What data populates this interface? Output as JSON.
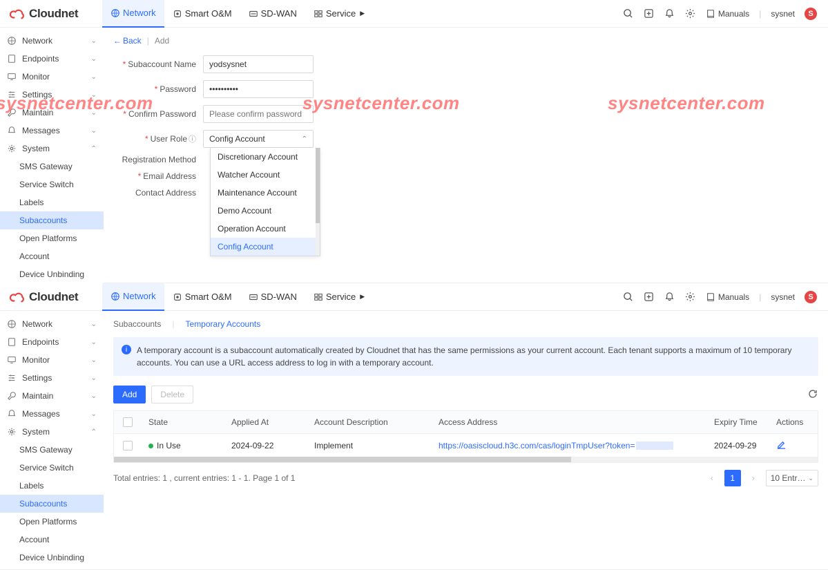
{
  "brand": "Cloudnet",
  "topnav": [
    "Network",
    "Smart O&M",
    "SD-WAN",
    "Service"
  ],
  "topright": {
    "manuals": "Manuals",
    "user": "sysnet",
    "avatar_letter": "S"
  },
  "sidenav": [
    {
      "label": "Network"
    },
    {
      "label": "Endpoints"
    },
    {
      "label": "Monitor"
    },
    {
      "label": "Settings"
    },
    {
      "label": "Maintain"
    },
    {
      "label": "Messages"
    },
    {
      "label": "System",
      "open": true,
      "children": [
        "SMS Gateway",
        "Service Switch",
        "Labels",
        "Subaccounts",
        "Open Platforms",
        "Account",
        "Device Unbinding"
      ]
    }
  ],
  "shot1": {
    "back": "Back",
    "crumb": "Add",
    "form": {
      "subaccount_label": "Subaccount Name",
      "subaccount_value": "yodsysnet",
      "password_label": "Password",
      "password_value": "••••••••••",
      "confirm_label": "Confirm Password",
      "confirm_placeholder": "Please confirm password",
      "role_label": "User Role",
      "role_value": "Config Account",
      "role_options": [
        "Discretionary Account",
        "Watcher Account",
        "Maintenance Account",
        "Demo Account",
        "Operation Account",
        "Config Account"
      ],
      "reg_label": "Registration Method",
      "email_label": "Email Address",
      "contact_label": "Contact Address"
    }
  },
  "shot2": {
    "crumb1": "Subaccounts",
    "crumb2": "Temporary Accounts",
    "alert": "A temporary account is a subaccount automatically created by Cloudnet that has the same permissions as your current account. Each tenant supports a maximum of 10 temporary accounts. You can use a URL access address to log in with a temporary account.",
    "add": "Add",
    "delete": "Delete",
    "cols": {
      "state": "State",
      "applied": "Applied At",
      "desc": "Account Description",
      "access": "Access Address",
      "expiry": "Expiry Time",
      "actions": "Actions"
    },
    "row": {
      "state": "In Use",
      "applied": "2024-09-22",
      "desc": "Implement",
      "access": "https://oasiscloud.h3c.com/cas/loginTmpUser?token=",
      "expiry": "2024-09-29"
    },
    "pager_summary": "Total entries: 1 , current entries: 1 - 1. Page 1 of 1",
    "page": "1",
    "page_size": "10 Entr…"
  },
  "watermark": "sysnetcenter.com"
}
